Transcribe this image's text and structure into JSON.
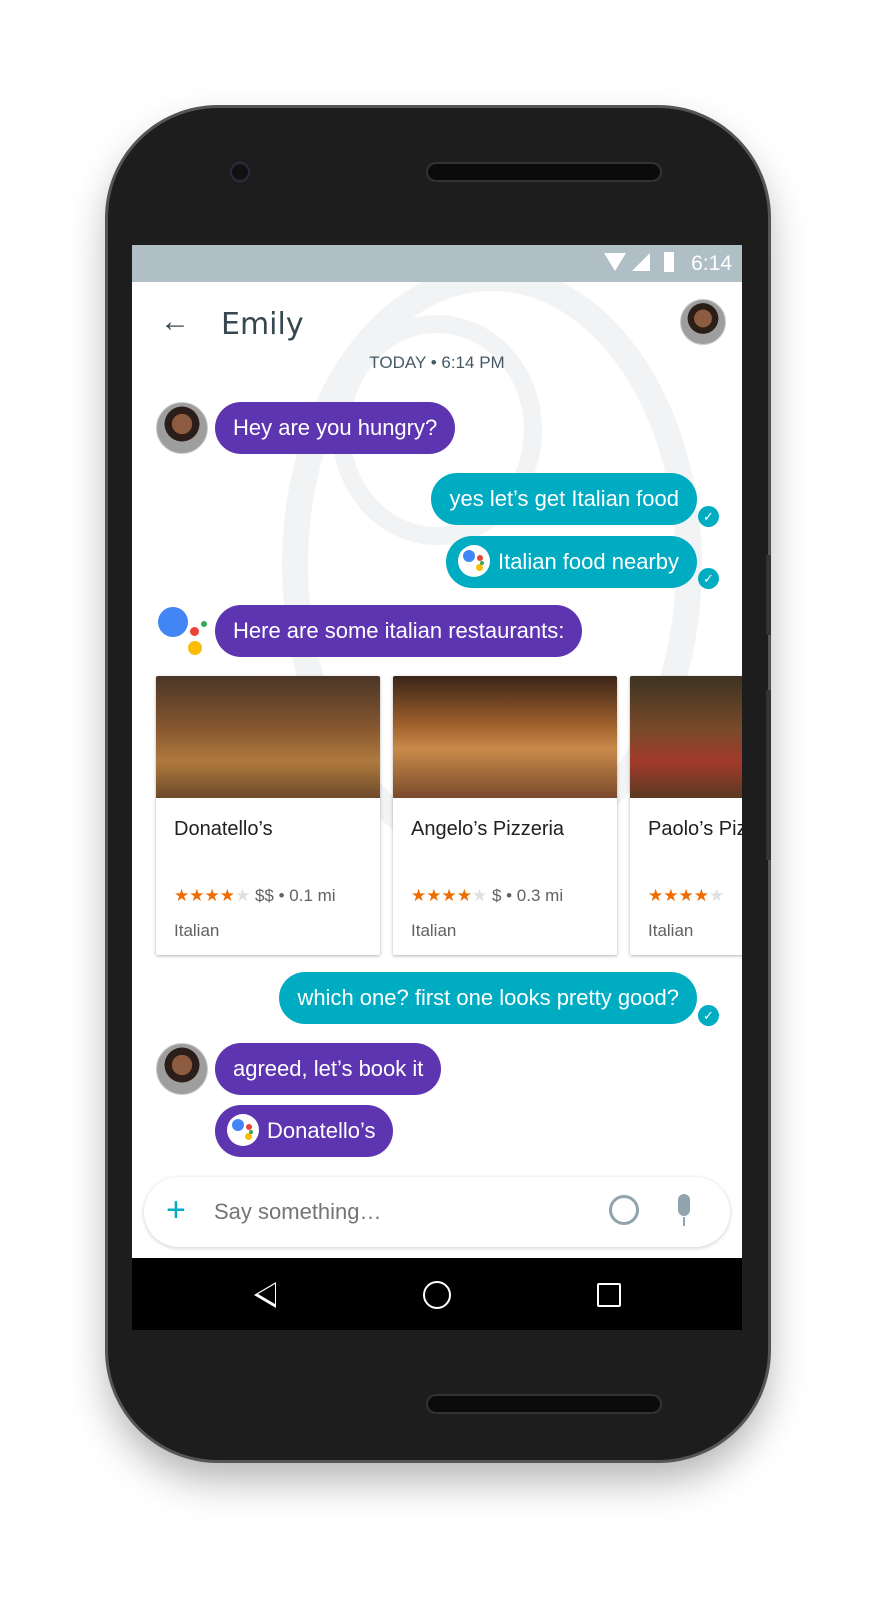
{
  "status_bar": {
    "time": "6:14",
    "icons": [
      "wifi-icon",
      "signal-icon",
      "battery-icon"
    ]
  },
  "header": {
    "title": "Emily",
    "back_icon": "arrow-left-icon"
  },
  "date_label": "TODAY • 6:14 PM",
  "messages": [
    {
      "from": "Emily",
      "text": "Hey are you hungry?"
    },
    {
      "from": "me",
      "text": "yes let’s get Italian food",
      "status": "sent"
    },
    {
      "from": "me",
      "text": "Italian food nearby",
      "assistant_query": true,
      "status": "sent"
    },
    {
      "from": "assistant",
      "text": "Here are some italian restaurants:"
    },
    {
      "from": "me",
      "text": "which one? first one looks pretty good?",
      "status": "sent"
    },
    {
      "from": "Emily",
      "text": "agreed, let’s book it"
    },
    {
      "from": "Emily",
      "text": "Donatello’s",
      "assistant_query": true
    }
  ],
  "restaurants": [
    {
      "name": "Donatello’s",
      "rating": 4,
      "price": "$$",
      "distance": "0.1 mi",
      "meta": "$$ • 0.1 mi",
      "cuisine": "Italian"
    },
    {
      "name": "Angelo’s Pizzeria",
      "rating": 4,
      "price": "$",
      "distance": "0.3 mi",
      "meta": "$ • 0.3 mi",
      "cuisine": "Italian"
    },
    {
      "name": "Paolo’s Piz",
      "rating": 4,
      "meta": "",
      "cuisine": "Italian"
    }
  ],
  "composer": {
    "placeholder": "Say something…"
  },
  "colors": {
    "purple": "#5e35b1",
    "teal": "#00acc1",
    "status_bar": "#b0bec5",
    "star": "#ef6c00"
  }
}
